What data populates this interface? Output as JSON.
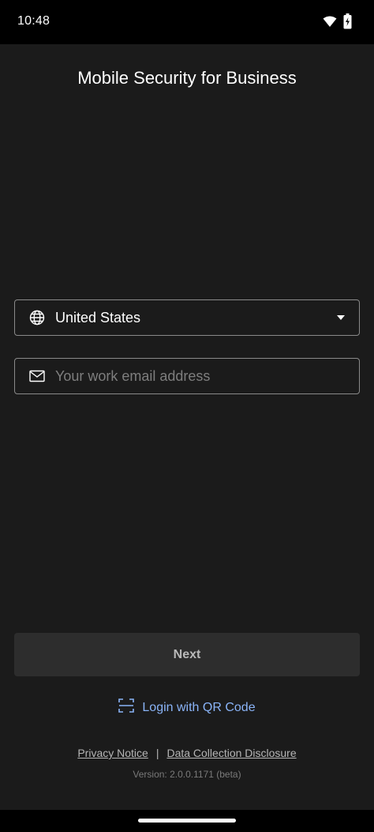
{
  "status_bar": {
    "time": "10:48",
    "icons": [
      "wifi-icon",
      "battery-charging-icon"
    ]
  },
  "app": {
    "title": "Mobile Security for Business"
  },
  "country_select": {
    "icon": "globe-icon",
    "value": "United States",
    "dropdown_icon": "caret-down-icon"
  },
  "email_field": {
    "icon": "mail-icon",
    "value": "",
    "placeholder": "Your work email address"
  },
  "next_button": {
    "label": "Next"
  },
  "qr_login": {
    "icon": "qr-scan-icon",
    "label": "Login with QR Code"
  },
  "legal": {
    "privacy_notice": "Privacy Notice",
    "separator": "|",
    "data_collection": "Data Collection Disclosure"
  },
  "version": "Version: 2.0.0.1171 (beta)",
  "colors": {
    "background": "#1b1b1b",
    "accent_link": "#8ab4f8",
    "button_bg": "#2d2d2d",
    "border": "#8a8a8a"
  }
}
